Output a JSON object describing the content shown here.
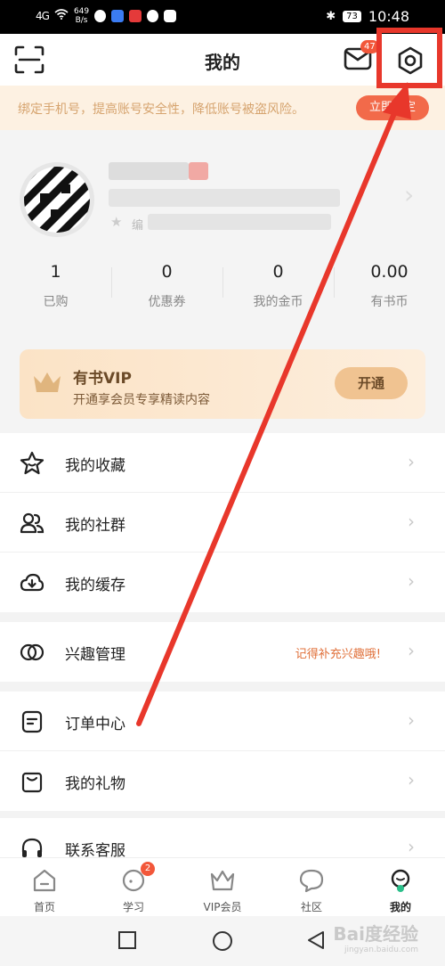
{
  "status_bar": {
    "network": "4G",
    "speed_value": "649",
    "speed_unit": "B/s",
    "battery": "73",
    "time": "10:48"
  },
  "header": {
    "title": "我的",
    "mail_badge": "47"
  },
  "bind_bar": {
    "text": "绑定手机号，提高账号安全性，降低账号被盗风险。",
    "button": "立即绑定"
  },
  "profile": {
    "edit_label": "编"
  },
  "stats": [
    {
      "value": "1",
      "label": "已购"
    },
    {
      "value": "0",
      "label": "优惠券"
    },
    {
      "value": "0",
      "label": "我的金币"
    },
    {
      "value": "0.00",
      "label": "有书币"
    }
  ],
  "vip": {
    "title": "有书VIP",
    "subtitle": "开通享会员专享精读内容",
    "button": "开通"
  },
  "menu": {
    "group1": [
      {
        "icon": "star-face-icon",
        "label": "我的收藏"
      },
      {
        "icon": "people-icon",
        "label": "我的社群"
      },
      {
        "icon": "cloud-download-icon",
        "label": "我的缓存"
      }
    ],
    "group2": [
      {
        "icon": "interest-icon",
        "label": "兴趣管理",
        "hint": "记得补充兴趣哦!"
      }
    ],
    "group3": [
      {
        "icon": "order-icon",
        "label": "订单中心"
      },
      {
        "icon": "gift-bag-icon",
        "label": "我的礼物"
      }
    ],
    "group4": [
      {
        "icon": "headset-icon",
        "label": "联系客服"
      }
    ]
  },
  "tabs": [
    {
      "label": "首页",
      "icon": "home-icon"
    },
    {
      "label": "学习",
      "icon": "study-icon",
      "badge": "2"
    },
    {
      "label": "VIP会员",
      "icon": "crown-icon"
    },
    {
      "label": "社区",
      "icon": "chat-bubble-icon"
    },
    {
      "label": "我的",
      "icon": "profile-icon",
      "active": true
    }
  ],
  "watermark": {
    "main": "Bai度经验",
    "sub": "jingyan.baidu.com"
  },
  "colors": {
    "accent_red": "#f2573a",
    "annotation_red": "#e8372b",
    "vip_brown": "#6b4a28",
    "bind_text": "#d6a46f"
  }
}
